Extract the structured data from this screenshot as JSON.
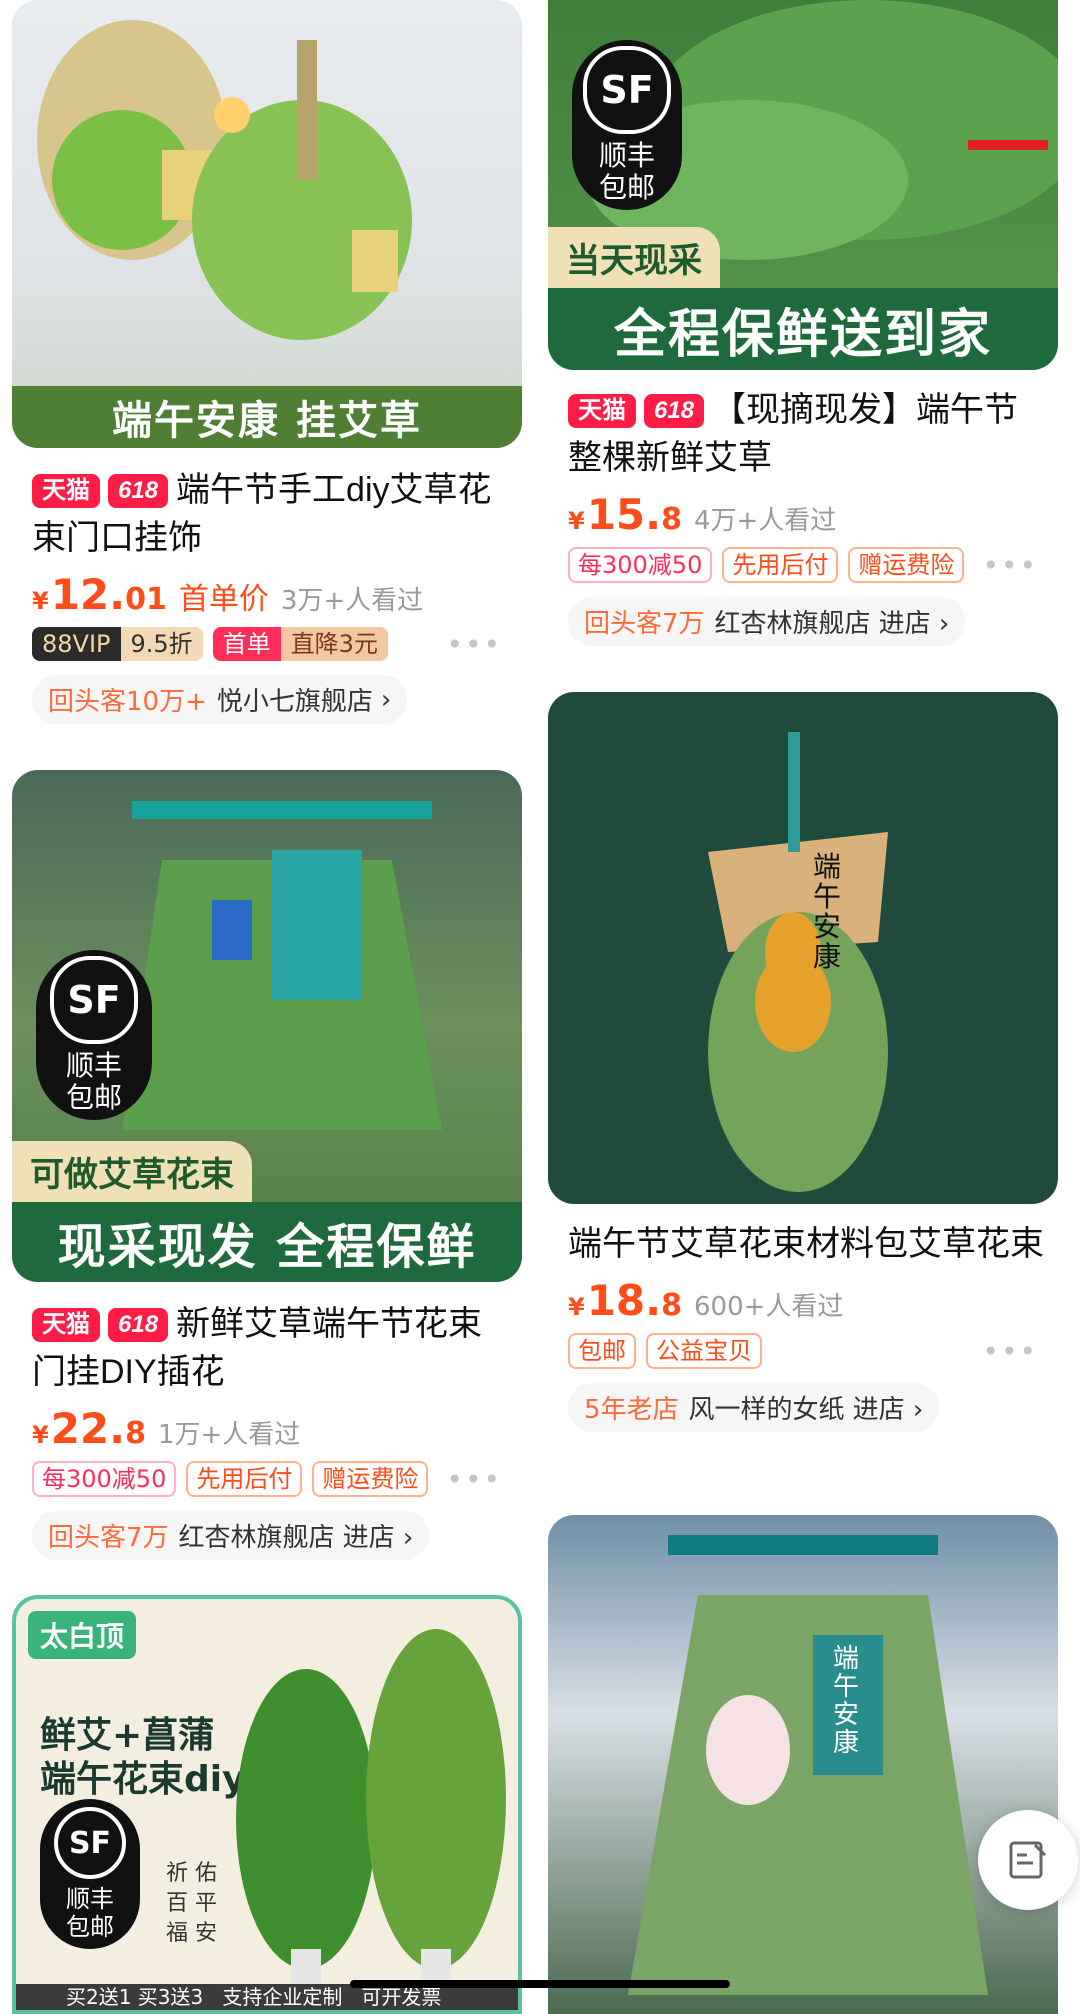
{
  "feed": {
    "left": [
      {
        "image_text": "端午安康 挂艾草",
        "tags": [
          "天猫",
          "618"
        ],
        "title": "端午节手工diy艾草花束门口挂饰",
        "price": {
          "yen": "¥",
          "int": "12.",
          "dec": "01"
        },
        "first_price_label": "首单价",
        "viewers": "3万+人看过",
        "promos": {
          "vip_a": "88VIP",
          "vip_b": "9.5折",
          "first_a": "首单",
          "first_b": "直降3元"
        },
        "store": {
          "repeat": "回头客10万+",
          "name": "悦小七旗舰店",
          "enter": "›"
        }
      },
      {
        "image_subtag": "可做艾草花束",
        "image_text": "现采现发 全程保鲜",
        "sf": {
          "logo": "SF",
          "text1": "顺丰",
          "text2": "包邮"
        },
        "tags": [
          "天猫",
          "618"
        ],
        "title": "新鲜艾草端午节花束门挂DIY插花",
        "price": {
          "yen": "¥",
          "int": "22.",
          "dec": "8"
        },
        "viewers": "1万+人看过",
        "promos": [
          "每300减50",
          "先用后付",
          "赠运费险"
        ],
        "store": {
          "repeat": "回头客7万",
          "name": "红杏林旗舰店",
          "enter": "进店 ›"
        }
      },
      {
        "brand": "太白顶",
        "headline1": "鲜艾+菖蒲",
        "headline2": "端午花束diy",
        "sf": {
          "logo": "SF",
          "text1": "顺丰",
          "text2": "包邮"
        },
        "side_text": "祈 佑 百 平 福 安",
        "bottom_strip": "买2送1 买3送3   支持企业定制   可开发票"
      }
    ],
    "right": [
      {
        "image_subtag": "当天现采",
        "image_text": "全程保鲜送到家",
        "sf": {
          "logo": "SF",
          "text1": "顺丰",
          "text2": "包邮"
        },
        "tags": [
          "天猫",
          "618"
        ],
        "title": "【现摘现发】端午节整棵新鲜艾草",
        "price": {
          "yen": "¥",
          "int": "15.",
          "dec": "8"
        },
        "viewers": "4万+人看过",
        "promos": [
          "每300减50",
          "先用后付",
          "赠运费险"
        ],
        "store": {
          "repeat": "回头客7万",
          "name": "红杏林旗舰店",
          "enter": "进店 ›"
        }
      },
      {
        "image_text_on_tag": "端午安康",
        "title": "端午节艾草花束材料包艾草花束",
        "price": {
          "yen": "¥",
          "int": "18.",
          "dec": "8"
        },
        "viewers": "600+人看过",
        "promos": [
          "包邮",
          "公益宝贝"
        ],
        "store": {
          "repeat": "5年老店",
          "name": "风一样的女纸",
          "enter": "进店 ›"
        }
      },
      {
        "image_text_on_tag": "端午安康"
      }
    ]
  },
  "more_label": "•••",
  "colors": {
    "accent": "#ff4d1a",
    "tmall": "#ff1d48",
    "banner_green": "#1f6a3c"
  },
  "icons": {
    "fab": "edit-note-icon"
  }
}
